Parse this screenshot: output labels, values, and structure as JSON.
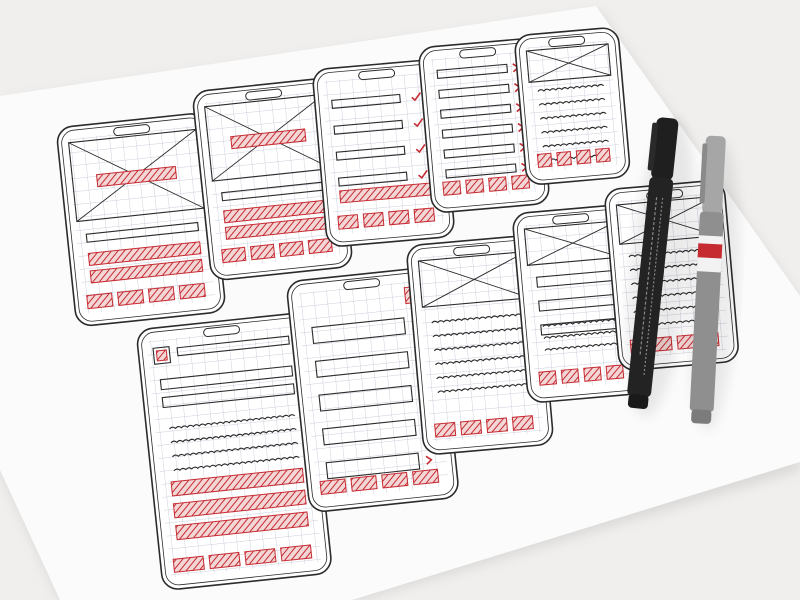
{
  "scene": {
    "description_visible_text": [],
    "colors": {
      "background": "#f0efee",
      "paper": "#fbfbfb",
      "paper_shadow": "#d9d8d6",
      "grid": "#b9bfd0",
      "ink": "#2b2b2b",
      "accent": "#c62b32",
      "marker_body": "#222222",
      "pen_body": "#8f8f8f",
      "pen_cap": "#a9a9a9"
    }
  },
  "wireframes": [
    {
      "type": "image-placeholder-screen"
    },
    {
      "type": "image-placeholder-screen"
    },
    {
      "type": "list-with-checkmarks"
    },
    {
      "type": "list-with-chevrons"
    },
    {
      "type": "text-lines-screen"
    },
    {
      "type": "menu-text-screen"
    },
    {
      "type": "form-screen"
    },
    {
      "type": "text-lines-screen"
    },
    {
      "type": "image-form-screen"
    },
    {
      "type": "text-lines-screen"
    }
  ],
  "pens": [
    {
      "type": "marker",
      "brand_text": ""
    },
    {
      "type": "fineliner",
      "brand_text": ""
    }
  ]
}
